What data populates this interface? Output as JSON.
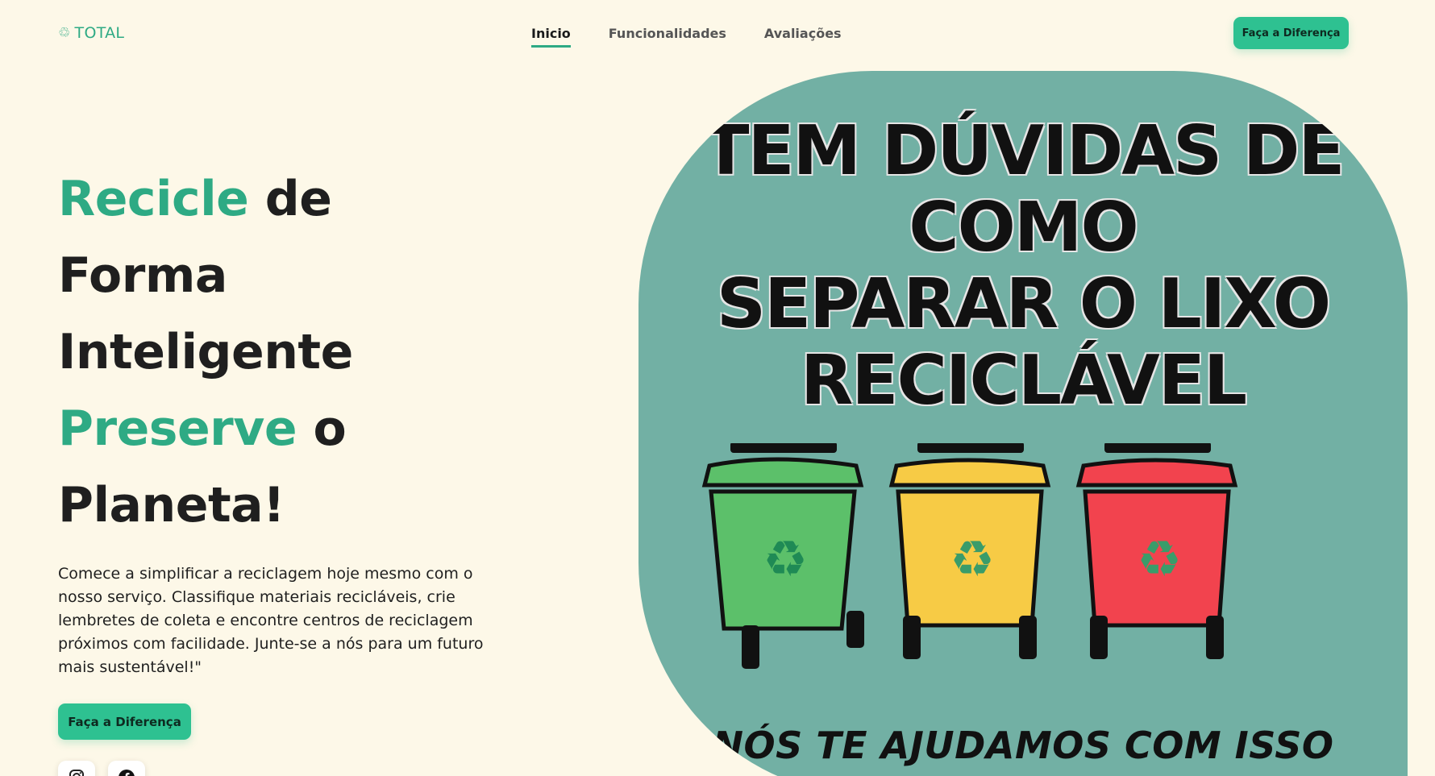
{
  "header": {
    "logo_text": "TOTAL",
    "nav": [
      "Inicio",
      "Funcionalidades",
      "Avaliações"
    ],
    "active_index": 0,
    "cta_label": "Faça a Diferença"
  },
  "hero": {
    "line1_accent": "Recicle",
    "line1_rest": " de",
    "line2": "Forma",
    "line3": "Inteligente",
    "line4_accent": "Preserve",
    "line4_rest": " o",
    "line5": "Planeta!",
    "description": "Comece a simplificar a reciclagem hoje mesmo com o nosso serviço. Classifique materiais recicláveis, crie lembretes de coleta e encontre centros de reciclagem próximos com facilidade. Junte-se a nós para um futuro mais sustentável!\"",
    "cta_label": "Faça a Diferença"
  },
  "socials": [
    "instagram-icon",
    "facebook-icon"
  ],
  "banner": {
    "title_lines": [
      "TEM DÚVIDAS DE",
      "COMO",
      "SEPARAR O LIXO",
      "RECICLÁVEL"
    ],
    "footer": "NÓS TE AJUDAMOS COM ISSO",
    "bin_colors": [
      "#5cc06a",
      "#f7cb45",
      "#f2434e"
    ]
  },
  "colors": {
    "accent": "#2eaa84",
    "button": "#2ec191",
    "background": "#fdf8e8",
    "panel": "#72b0a4"
  }
}
